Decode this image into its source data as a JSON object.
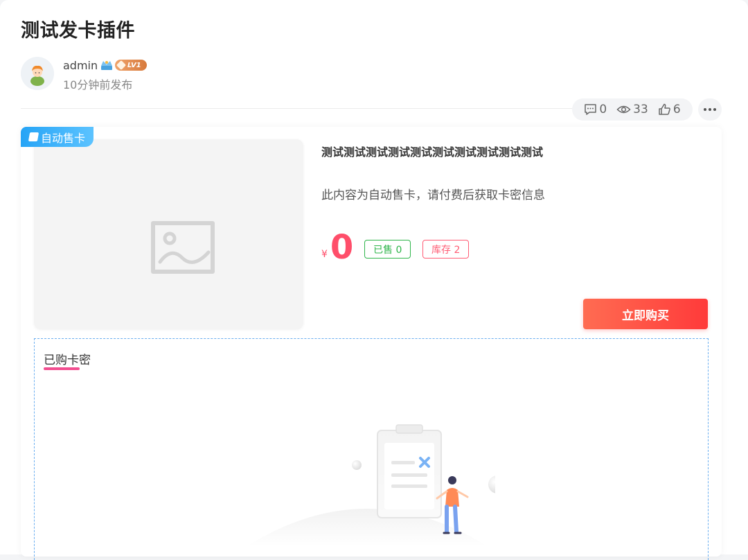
{
  "post": {
    "title": "测试发卡插件",
    "author": {
      "name": "admin",
      "level": "LV1",
      "time": "10分钟前发布"
    },
    "stats": {
      "comments": "0",
      "views": "33",
      "likes": "6"
    }
  },
  "product": {
    "ribbon": "自动售卡",
    "title": "测试测试测试测试测试测试测试测试测试测试",
    "description": "此内容为自动售卡，请付费后获取卡密信息",
    "currency": "¥",
    "price": "0",
    "sold_label": "已售 0",
    "stock_label": "库存 2",
    "buy_button": "立即购买"
  },
  "bought": {
    "title": "已购卡密"
  },
  "colors": {
    "accent_price": "#ff4e6a",
    "buy_button": "#ff3a3a",
    "ribbon": "#26a4f6",
    "sold_tag": "#2eb54a",
    "stock_tag": "#ff5c74",
    "underline": "#f24e90"
  },
  "icons": {
    "comment": "comment-icon",
    "view": "eye-icon",
    "like": "thumbs-up-icon",
    "more": "more-dots-icon",
    "ribbon": "book-icon",
    "thumb": "image-placeholder-icon",
    "vip": "vip-crown-icon",
    "level": "level-gem-icon",
    "empty": "empty-clipboard-illustration"
  }
}
